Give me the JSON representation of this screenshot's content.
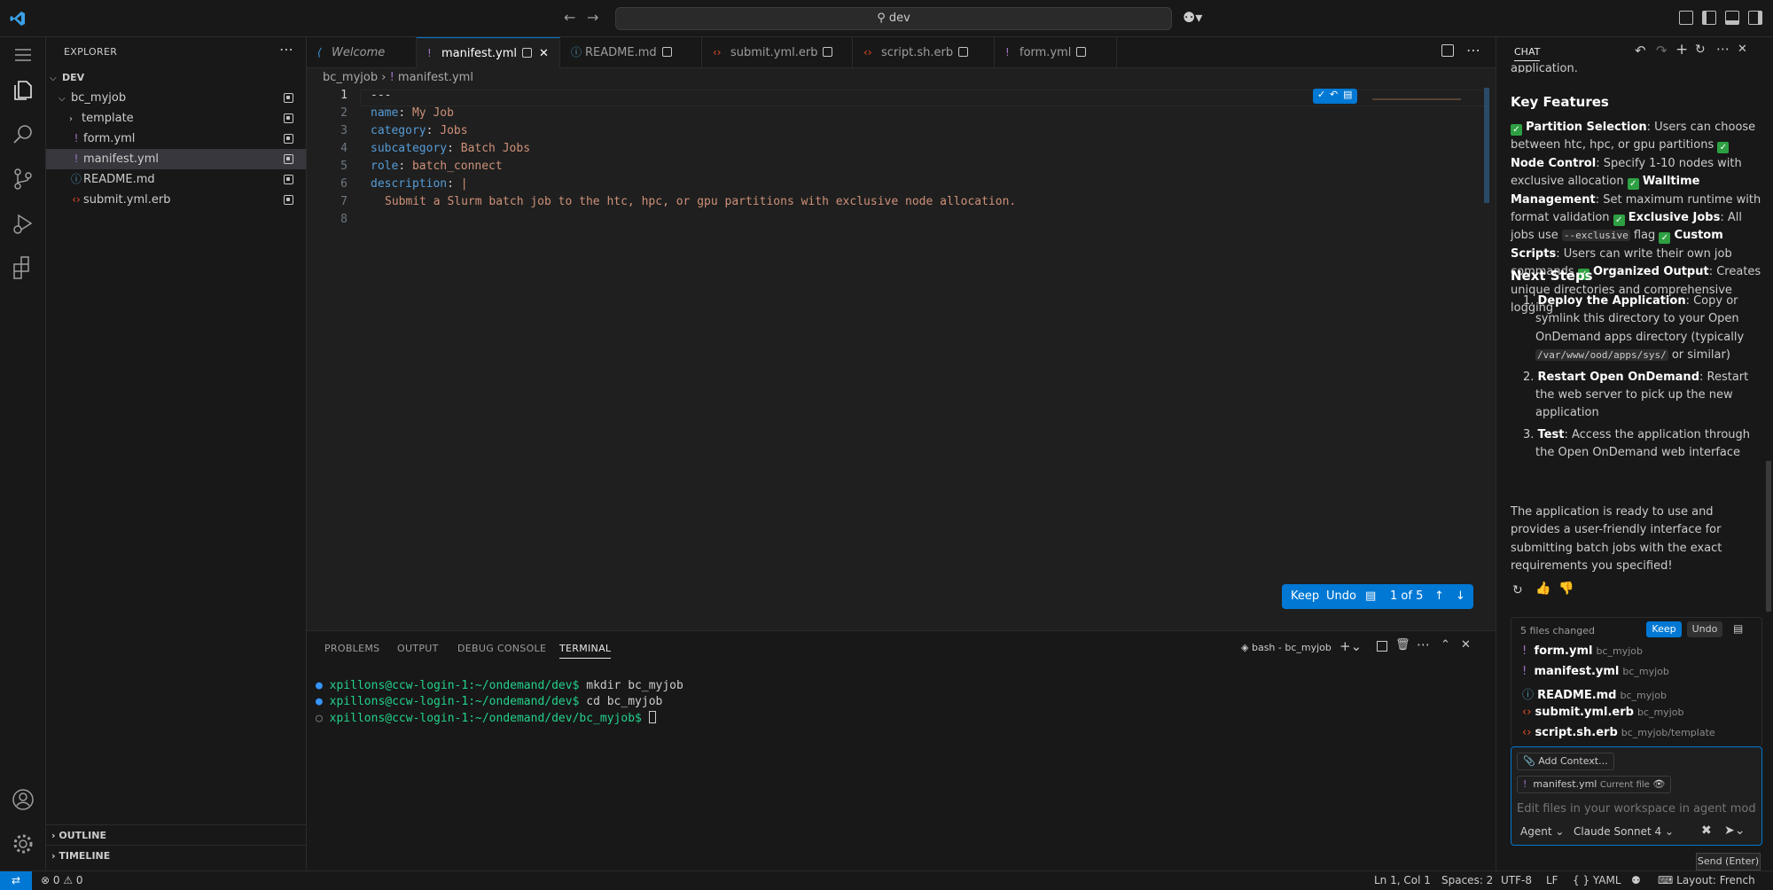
{
  "titlebar": {
    "search": "dev"
  },
  "explorer": {
    "title": "EXPLORER",
    "root": "DEV",
    "folder": "bc_myjob",
    "items": [
      {
        "name": "template",
        "kind": "folder"
      },
      {
        "name": "form.yml",
        "kind": "yaml"
      },
      {
        "name": "manifest.yml",
        "kind": "yaml"
      },
      {
        "name": "README.md",
        "kind": "info"
      },
      {
        "name": "submit.yml.erb",
        "kind": "erb"
      }
    ],
    "outline": "OUTLINE",
    "timeline": "TIMELINE"
  },
  "tabs": [
    {
      "label": "Welcome",
      "icon": "vscode-icon"
    },
    {
      "label": "manifest.yml",
      "icon": "yaml-icon"
    },
    {
      "label": "README.md",
      "icon": "info-icon"
    },
    {
      "label": "submit.yml.erb",
      "icon": "erb-icon"
    },
    {
      "label": "script.sh.erb",
      "icon": "erb-icon"
    },
    {
      "label": "form.yml",
      "icon": "yaml-icon"
    }
  ],
  "breadcrumb": {
    "folder": "bc_myjob",
    "file": "manifest.yml"
  },
  "code": {
    "line_numbers": [
      "1",
      "2",
      "3",
      "4",
      "5",
      "6",
      "7",
      "8"
    ],
    "l1": "---",
    "l2k": "name",
    "l2v": "My Job",
    "l3k": "category",
    "l3v": "Jobs",
    "l4k": "subcategory",
    "l4v": "Batch Jobs",
    "l5k": "role",
    "l5v": "batch_connect",
    "l6k": "description",
    "l6v": "|",
    "l7": "Submit a Slurm batch job to the htc, hpc, or gpu partitions with exclusive node allocation."
  },
  "keep_bar": {
    "keep": "Keep",
    "undo": "Undo",
    "count": "1 of 5"
  },
  "panel": {
    "tabs": [
      "PROBLEMS",
      "OUTPUT",
      "DEBUG CONSOLE",
      "TERMINAL"
    ],
    "terminal_name": "bash - bc_myjob",
    "lines": [
      {
        "prompt": "xpillons@ccw-login-1:~/ondemand/dev$",
        "cmd": " mkdir bc_myjob"
      },
      {
        "prompt": "xpillons@ccw-login-1:~/ondemand/dev$",
        "cmd": " cd bc_myjob"
      },
      {
        "prompt": "xpillons@ccw-login-1:~/ondemand/dev/bc_myjob$",
        "cmd": " "
      }
    ]
  },
  "chat": {
    "title": "CHAT",
    "top_fragment": "application.",
    "key_features_heading": "Key Features",
    "f1b": "Partition Selection",
    "f1": ": Users can choose between htc, hpc, or gpu partitions ",
    "f2b": "Node Control",
    "f2": ": Specify 1-10 nodes with exclusive allocation ",
    "f3b": "Walltime Management",
    "f3": ": Set maximum runtime with format validation ",
    "f4b": "Exclusive Jobs",
    "f4": ": All jobs use ",
    "f4code": "--exclusive",
    "f4end": " flag ",
    "f5b": "Custom Scripts",
    "f5": ": Users can write their own job commands ",
    "f6b": "Organized Output",
    "f6": ": Creates unique directories and comprehensive logging",
    "next_steps_heading": "Next Steps",
    "s1b": "Deploy the Application",
    "s1": ": Copy or symlink this directory to your Open OnDemand apps directory (typically ",
    "s1code": "/var/www/ood/apps/sys/",
    "s1end": " or similar)",
    "s2b": "Restart Open OnDemand",
    "s2": ": Restart the web server to pick up the new application",
    "s3b": "Test",
    "s3": ": Access the application through the Open OnDemand web interface",
    "closing": "The application is ready to use and provides a user-friendly interface for submitting batch jobs with the exact requirements you specified!",
    "files_changed": "5 files changed",
    "keep": "Keep",
    "undo": "Undo",
    "files": [
      {
        "name": "form.yml",
        "dir": "bc_myjob"
      },
      {
        "name": "manifest.yml",
        "dir": "bc_myjob"
      },
      {
        "name": "README.md",
        "dir": "bc_myjob"
      },
      {
        "name": "submit.yml.erb",
        "dir": "bc_myjob"
      },
      {
        "name": "script.sh.erb",
        "dir": "bc_myjob/template"
      }
    ],
    "add_context": "Add Context...",
    "context_file": "manifest.yml",
    "context_tag": "Current file",
    "placeholder": "Edit files in your workspace in agent mode",
    "mode": "Agent",
    "model": "Claude Sonnet 4",
    "tooltip": "Send (Enter)"
  },
  "status": {
    "errors": "0",
    "warnings": "0",
    "position": "Ln 1, Col 1",
    "spaces": "Spaces: 2",
    "encoding": "UTF-8",
    "eol": "LF",
    "language": "YAML",
    "layout": "Layout: French"
  }
}
